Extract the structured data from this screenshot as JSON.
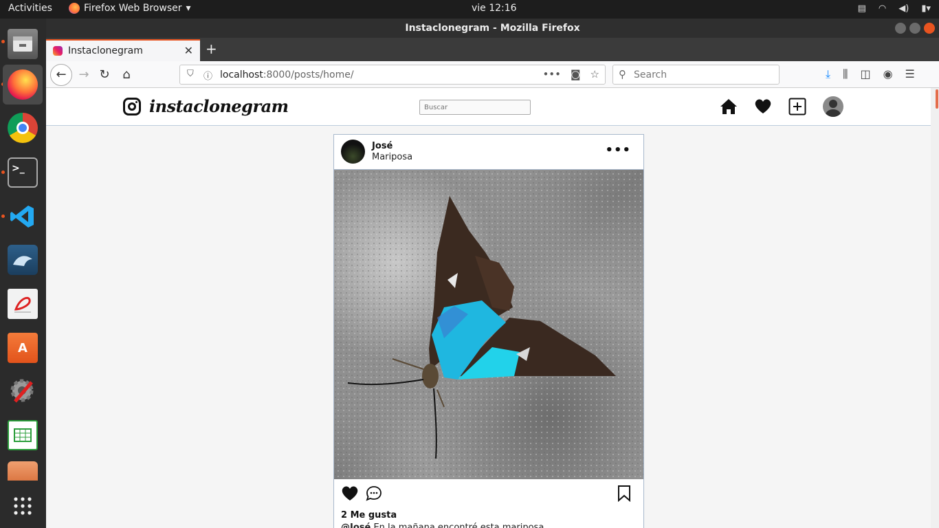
{
  "topbar": {
    "activities": "Activities",
    "app_name": "Firefox Web Browser",
    "clock": "vie 12:16"
  },
  "dock": {
    "items": [
      {
        "name": "files-icon"
      },
      {
        "name": "firefox-icon",
        "active": true
      },
      {
        "name": "chrome-icon"
      },
      {
        "name": "terminal-icon"
      },
      {
        "name": "vscode-icon"
      },
      {
        "name": "mysql-workbench-icon"
      },
      {
        "name": "document-viewer-icon"
      },
      {
        "name": "software-center-icon"
      },
      {
        "name": "system-tools-icon"
      },
      {
        "name": "spreadsheet-icon"
      },
      {
        "name": "presentation-icon"
      },
      {
        "name": "show-applications-icon"
      }
    ]
  },
  "window": {
    "title": "Instaclonegram - Mozilla Firefox"
  },
  "tab": {
    "label": "Instaclonegram"
  },
  "url": {
    "host": "localhost",
    "path": ":8000/posts/home/"
  },
  "searchbar": {
    "placeholder": "Search"
  },
  "site": {
    "brand": "instaclonegram",
    "search_placeholder": "Buscar"
  },
  "post": {
    "username": "José",
    "location": "Mariposa",
    "likes": "2 Me gusta",
    "caption_user": "@José",
    "caption_text": " En la mañana encontré esta mariposa"
  },
  "colors": {
    "accent": "#e95420",
    "butterfly_blue": "#1fc8e8"
  }
}
